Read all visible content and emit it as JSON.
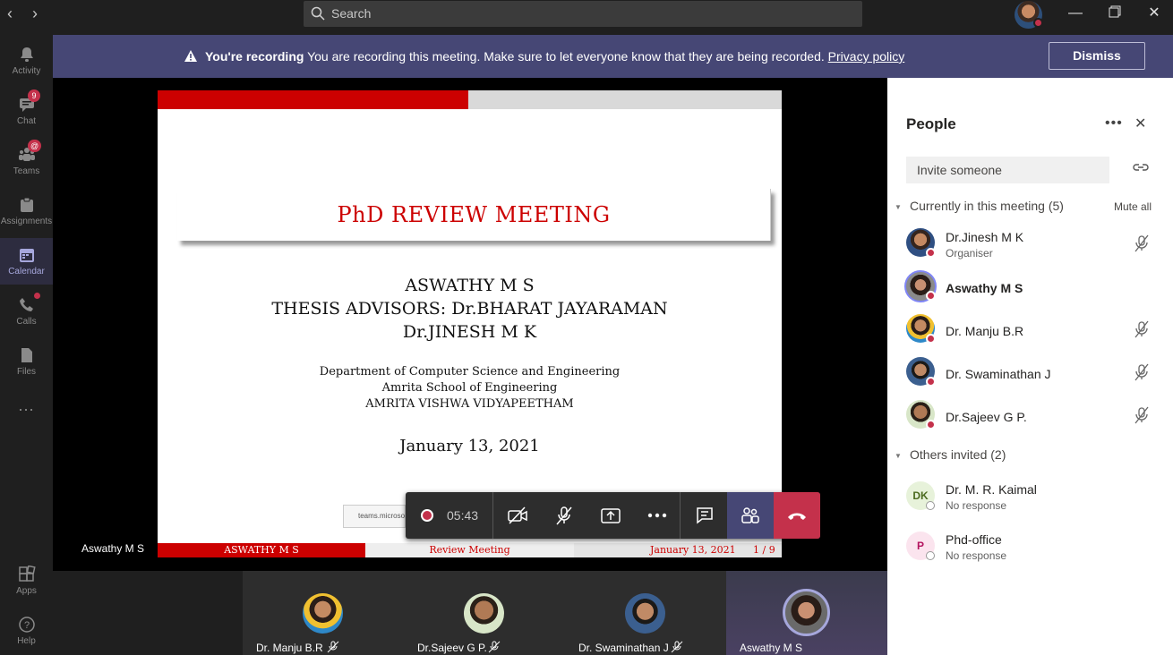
{
  "titlebar": {
    "search_placeholder": "Search",
    "back_icon": "chevron-left-icon",
    "forward_icon": "chevron-right-icon"
  },
  "rail": {
    "items": [
      {
        "label": "Activity",
        "icon": "bell-icon"
      },
      {
        "label": "Chat",
        "icon": "chat-icon",
        "badge": "9"
      },
      {
        "label": "Teams",
        "icon": "teams-icon",
        "badge": "@"
      },
      {
        "label": "Assignments",
        "icon": "assignments-icon"
      },
      {
        "label": "Calendar",
        "icon": "calendar-icon",
        "active": true
      },
      {
        "label": "Calls",
        "icon": "phone-icon"
      },
      {
        "label": "Files",
        "icon": "files-icon"
      },
      {
        "label": "...",
        "icon": "more-icon"
      },
      {
        "label": "Apps",
        "icon": "apps-icon"
      },
      {
        "label": "Help",
        "icon": "help-icon"
      }
    ]
  },
  "banner": {
    "bold": "You're recording",
    "text": "You are recording this meeting. Make sure to let everyone know that they are being recorded.",
    "link": "Privacy policy",
    "dismiss": "Dismiss",
    "color": "#464775"
  },
  "slide": {
    "title": "PhD REVIEW MEETING",
    "author": "ASWATHY M S",
    "advisors": "THESIS ADVISORS: Dr.BHARAT JAYARAMAN",
    "advisor2": "Dr.JINESH M K",
    "dept": "Department of Computer Science and Engineering",
    "school": "Amrita School of Engineering",
    "univ": "AMRITA VISHWA VIDYAPEETHAM",
    "date": "January 13, 2021",
    "footer_author": "ASWATHY M S",
    "footer_title": "Review Meeting",
    "footer_date": "January 13, 2021",
    "footer_page": "1 / 9",
    "share_tip": "teams.microso"
  },
  "stage": {
    "presenter": "Aswathy M S"
  },
  "controls": {
    "timer": "05:43"
  },
  "strip": [
    {
      "name": "Dr. Manju B.R"
    },
    {
      "name": "Dr.Sajeev G P."
    },
    {
      "name": "Dr. Swaminathan J"
    },
    {
      "name": "Aswathy M S"
    }
  ],
  "people": {
    "title": "People",
    "invite_placeholder": "Invite someone",
    "current_heading": "Currently in this meeting",
    "current_count": "(5)",
    "mute_all": "Mute all",
    "current": [
      {
        "name": "Dr.Jinesh M K",
        "role": "Organiser",
        "muted": true
      },
      {
        "name": "Aswathy M S",
        "role": "",
        "muted": false
      },
      {
        "name": "Dr. Manju B.R",
        "role": "",
        "muted": true
      },
      {
        "name": "Dr. Swaminathan J",
        "role": "",
        "muted": true
      },
      {
        "name": "Dr.Sajeev G P.",
        "role": "",
        "muted": true
      }
    ],
    "others_heading": "Others invited",
    "others_count": "(2)",
    "others": [
      {
        "name": "Dr. M. R. Kaimal",
        "status": "No response",
        "initials": "DK"
      },
      {
        "name": "Phd-office",
        "status": "No response",
        "initials": "P"
      }
    ]
  },
  "colors": {
    "accent": "#464775",
    "hangup": "#c4314b",
    "slide_red": "#cc0000"
  }
}
